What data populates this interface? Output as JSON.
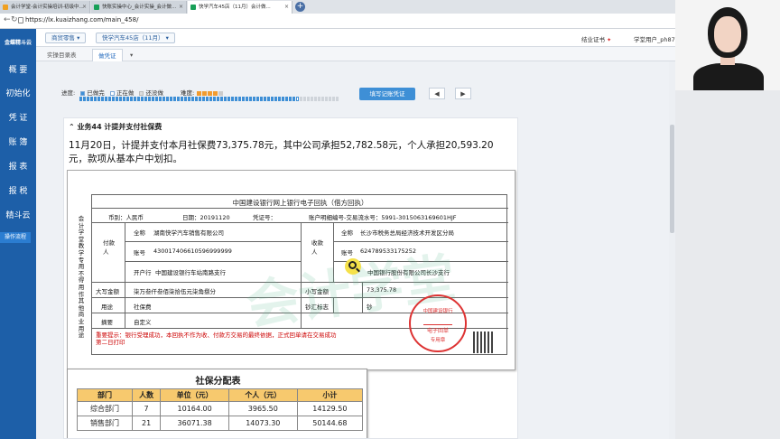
{
  "browser": {
    "tabs": [
      {
        "title": "会计学堂-会计实操培训-初级中..."
      },
      {
        "title": "快账实操中心_会计实操_会计做..."
      },
      {
        "title": "快学汽车45店（11月）会计做..."
      }
    ],
    "url": "https://lx.kuaizhang.com/main_458/"
  },
  "sidebar": {
    "logo": "金蝶精斗云",
    "items": [
      "概 要",
      "初始化",
      "凭 证",
      "账 簿",
      "报 表",
      "报 税",
      "精斗云"
    ],
    "flow_button": "操作流程"
  },
  "topbar": {
    "dept_select": "商贸零售",
    "company_select": "快学汽车45店（11月）",
    "cert_label": "结业证书",
    "user": "学堂用户_ph87"
  },
  "page_tabs": [
    "实操目录表",
    "做凭证"
  ],
  "progress": {
    "label": "进度:",
    "legend": [
      "已做完",
      "正在做",
      "还没做"
    ],
    "difficulty_label": "难度:",
    "difficulty_stars": 4,
    "difficulty_max": 5,
    "done_fraction": 0.84,
    "fill_button": "填写记账凭证"
  },
  "task": {
    "title": "业务44 计提并支付社保费",
    "description": "11月20日，计提并支付本月社保费73,375.78元，其中公司承担52,782.58元，个人承担20,593.20元，款项从基本户中划扣。"
  },
  "receipt": {
    "title": "中国建设银行网上银行电子回执（借方回执）",
    "side_text": "会计学堂教学专用不得用作其他商业用途",
    "currency": "币别：人民币",
    "date": "日期：20191120",
    "voucher_no": "凭证号：",
    "serial": "账户明细编号-交易流水号：5991-3015063169601HJF",
    "payer_label": "付款人",
    "payer_name_label": "全称",
    "payer_name": "湖南快学汽车销售有限公司",
    "payer_acct_label": "账号",
    "payer_acct": "430017406610596999999",
    "payer_bank_label": "开户行",
    "payer_bank": "中国建设银行车站南路支行",
    "payee_label": "收款人",
    "payee_name_label": "全称",
    "payee_name": "长沙市税务总局经济技术开发区分局",
    "payee_acct_label": "账号",
    "payee_acct": "624789533175252",
    "payee_bank": "中国银行股份有限公司长沙支行",
    "amount_words_label": "大写金额",
    "amount_words": "柒万叁仟叁佰柒拾伍元柒角捌分",
    "amount_num_label": "小写金额",
    "amount_num": "73,375.78",
    "purpose_label": "用途",
    "purpose": "社保费",
    "cash_label": "钞汇标志",
    "cash": "钞",
    "memo_label": "摘要",
    "memo": "自定义",
    "warning_line1": "重要提示：银行受理成功，本回执不作为收、付款方交易的最终依据，正式回单请在交易成功",
    "warning_line2": "第二日打印",
    "stamp_top": "中国建设银行",
    "stamp_mid": "电子回单",
    "stamp_bottom": "专用章",
    "watermark": "会计学堂"
  },
  "allocation": {
    "title": "社保分配表",
    "headers": [
      "部门",
      "人数",
      "单位（元）",
      "个人（元）",
      "小计"
    ],
    "rows": [
      [
        "综合部门",
        "7",
        "10164.00",
        "3965.50",
        "14129.50"
      ],
      [
        "销售部门",
        "21",
        "36071.38",
        "14073.30",
        "50144.68"
      ]
    ]
  },
  "colors": {
    "sidebar": "#1d5fa8",
    "accent": "#3e8fd6",
    "stamp": "#d33333"
  }
}
